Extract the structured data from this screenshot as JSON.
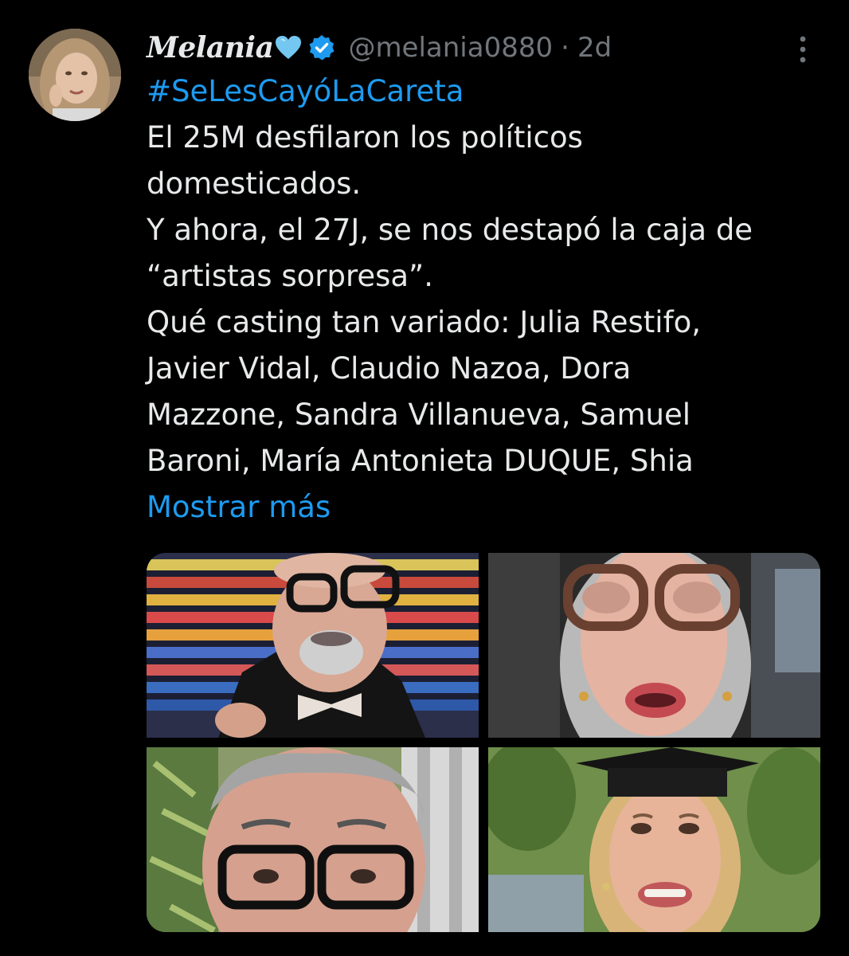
{
  "user": {
    "display_name": "Melania",
    "handle": "@melania0880",
    "separator": "·",
    "time": "2d"
  },
  "tweet": {
    "hashtag": "#SeLesCayóLaCareta",
    "lines": [
      "El 25M desfilaron los políticos",
      "domesticados.",
      "Y ahora, el 27J, se nos destapó la caja de",
      "“artistas sorpresa”.",
      "Qué casting tan variado: Julia Restifo,",
      "Javier Vidal, Claudio Nazoa, Dora",
      "Mazzone, Sandra Villanueva, Samuel",
      "Baroni, María Antonieta DUQUE, Shia"
    ],
    "show_more": "Mostrar más"
  },
  "media": [
    {
      "icon": "photo-man-bowtie-glasses"
    },
    {
      "icon": "photo-woman-glasses-car"
    },
    {
      "icon": "photo-man-gray-hair-glasses"
    },
    {
      "icon": "photo-woman-graduation-cap"
    }
  ],
  "colors": {
    "background": "#000000",
    "text": "#e7e9ea",
    "secondary": "#71767b",
    "link": "#1d9bf0",
    "verified": "#1d9bf0",
    "heart": "#74c7f0"
  }
}
